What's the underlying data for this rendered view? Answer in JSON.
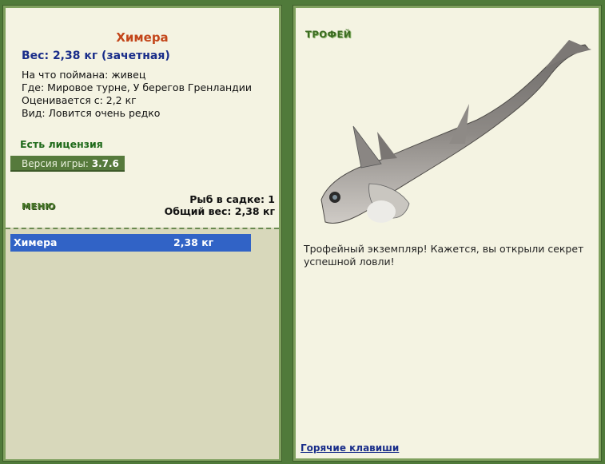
{
  "fish": {
    "name": "Химера",
    "weight": "Вес: 2,38 кг (зачетная)",
    "caught_with": "На что поймана: живец",
    "location": "Где: Мировое турне, У берегов Гренландии",
    "rated_from": "Оценивается с: 2,2 кг",
    "view": "Вид: Ловится очень редко"
  },
  "license": "Есть лицензия",
  "version": {
    "label": "Версия игры:",
    "value": "3.7.6"
  },
  "menu_label": "МЕНЮ",
  "stats": {
    "count": "Рыб в садке: 1",
    "total": "Общий вес: 2,38 кг"
  },
  "cage": [
    {
      "name": "Химера",
      "weight": "2,38 кг"
    }
  ],
  "trophy": {
    "title": "ТРОФЕЙ",
    "description": "Трофейный экземпляр! Кажется, вы открыли секрет успешной ловли!"
  },
  "hotkeys_label": "Горячие клавиши",
  "colors": {
    "frame": "#507a3a",
    "panel": "#f4f3e2",
    "selection": "#3163c6",
    "name": "#c3461a"
  }
}
